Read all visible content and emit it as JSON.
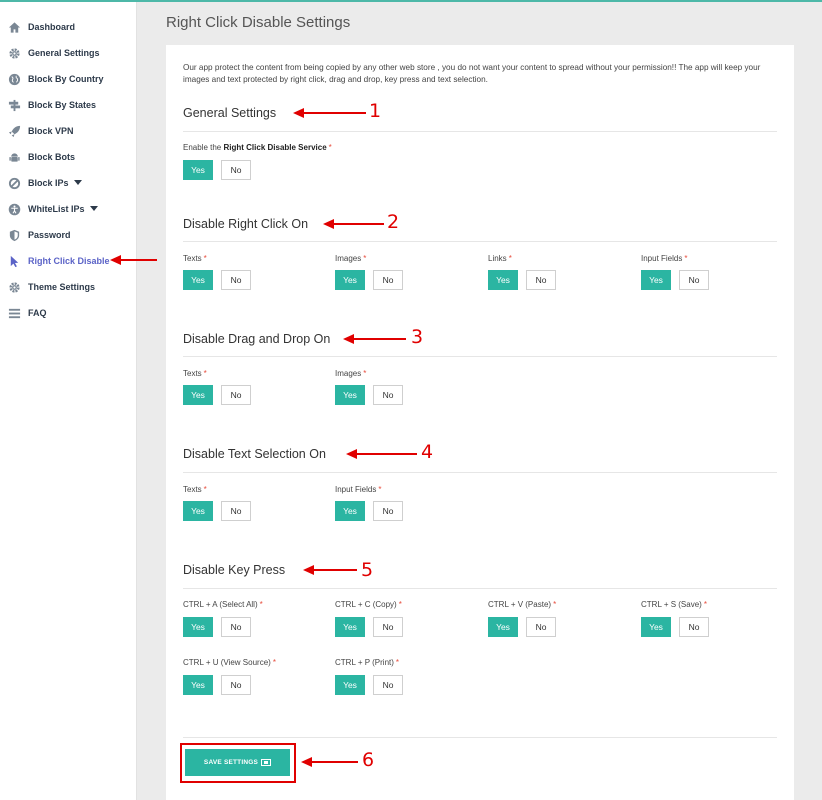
{
  "sidebar": {
    "items": [
      {
        "label": "Dashboard",
        "icon": "home-icon"
      },
      {
        "label": "General Settings",
        "icon": "gear-icon"
      },
      {
        "label": "Block By Country",
        "icon": "globe-icon"
      },
      {
        "label": "Block By States",
        "icon": "signpost-icon"
      },
      {
        "label": "Block VPN",
        "icon": "rocket-icon"
      },
      {
        "label": "Block Bots",
        "icon": "android-icon"
      },
      {
        "label": "Block IPs",
        "icon": "ban-icon",
        "has_dropdown": true
      },
      {
        "label": "WhiteList IPs",
        "icon": "accessibility-icon",
        "has_dropdown": true
      },
      {
        "label": "Password",
        "icon": "shield-icon"
      },
      {
        "label": "Right Click Disable",
        "icon": "cursor-icon",
        "active": true
      },
      {
        "label": "Theme Settings",
        "icon": "gear-icon"
      },
      {
        "label": "FAQ",
        "icon": "menu-icon"
      }
    ]
  },
  "page": {
    "title": "Right Click Disable Settings",
    "intro": "Our app protect the content from being copied by any other web store , you do not want your content to spread without your permission!! The app will keep your images and text protected by right click, drag and drop, key press and text selection."
  },
  "general": {
    "title": "General Settings",
    "label_prefix": "Enable the ",
    "label_bold": "Right Click Disable Service",
    "required": "*"
  },
  "sections": {
    "right_click": {
      "title": "Disable Right Click On",
      "fields": [
        "Texts",
        "Images",
        "Links",
        "Input Fields"
      ]
    },
    "drag_drop": {
      "title": "Disable Drag and Drop On",
      "fields": [
        "Texts",
        "Images"
      ]
    },
    "text_selection": {
      "title": "Disable Text Selection On",
      "fields": [
        "Texts",
        "Input Fields"
      ]
    },
    "key_press": {
      "title": "Disable Key Press",
      "fields": [
        "CTRL + A (Select All)",
        "CTRL + C (Copy)",
        "CTRL + V (Paste)",
        "CTRL + S (Save)",
        "CTRL + U (View Source)",
        "CTRL + P (Print)"
      ]
    }
  },
  "buttons": {
    "yes": "Yes",
    "no": "No",
    "save": "SAVE SETTINGS"
  },
  "annotations": [
    "1",
    "2",
    "3",
    "4",
    "5",
    "6"
  ],
  "colors": {
    "accent": "#2bb5a2",
    "active_nav": "#5b63c7",
    "required": "#e74c3c",
    "annotation": "#e00000"
  }
}
